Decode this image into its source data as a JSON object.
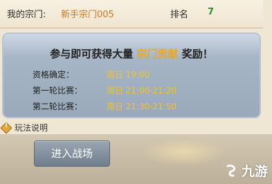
{
  "sect": {
    "label": "我的宗门:",
    "name": "新手宗门005",
    "rank_label": "排名",
    "rank_value": "7"
  },
  "event": {
    "headline_pre": "参与即可获得大量",
    "headline_highlight": "宗门贡献",
    "headline_post": "奖励！",
    "rows": [
      {
        "label": "资格确定：",
        "value": "周日 19:00"
      },
      {
        "label": "第一轮比赛：",
        "value": "周日 21:00-21:20"
      },
      {
        "label": "第二轮比赛：",
        "value": "周日 21:30-21:50"
      }
    ]
  },
  "help": {
    "label": "玩法说明"
  },
  "enter_button": {
    "label": "进入战场"
  },
  "watermark": {
    "text": "九游"
  },
  "colors": {
    "accent_orange": "#d2771e",
    "rank_green": "#2b8e2b",
    "time_yellow": "#f2c32a",
    "highlight_gold": "#e7a828"
  }
}
